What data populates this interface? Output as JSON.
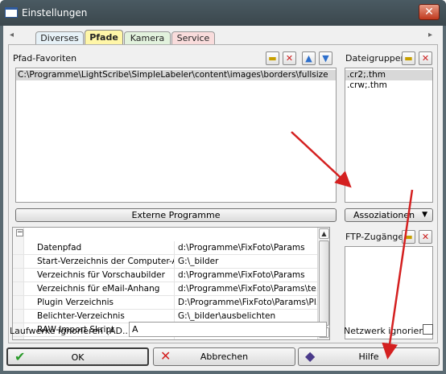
{
  "window": {
    "title": "Einstellungen",
    "close_glyph": "✕"
  },
  "tabs": [
    {
      "label": "Diverses",
      "color": "#e6f1f7"
    },
    {
      "label": "Pfade",
      "color": "#fff6a8",
      "active": true
    },
    {
      "label": "Kamera",
      "color": "#e2f2dd"
    },
    {
      "label": "Service",
      "color": "#f9dcdc"
    }
  ],
  "tab_scroll": {
    "left": "◂",
    "right": "▸"
  },
  "favorites": {
    "label": "Pfad-Favoriten",
    "items": [
      "C:\\Programme\\LightScribe\\SimpleLabeler\\content\\images\\borders\\fullsize"
    ]
  },
  "file_groups": {
    "label": "Dateigruppen",
    "items": [
      ".cr2;.thm",
      ".crw;.thm"
    ]
  },
  "external_programs_label": "Externe Programme",
  "associations_label": "Assoziationen",
  "ftp": {
    "label": "FTP-Zugänge"
  },
  "props": {
    "collapse_glyph": "−",
    "rows": [
      {
        "name": "Datenpfad",
        "value": "d:\\Programme\\FixFoto\\Params"
      },
      {
        "name": "Start-Verzeichnis der Computer-An...",
        "value": "G:\\_bilder"
      },
      {
        "name": "Verzeichnis für Vorschaubilder",
        "value": "d:\\Programme\\FixFoto\\Params"
      },
      {
        "name": "Verzeichnis für eMail-Anhang",
        "value": "d:\\Programme\\FixFoto\\Params\\te..."
      },
      {
        "name": "Plugin Verzeichnis",
        "value": "D:\\Programme\\FixFoto\\Params\\Pl..."
      },
      {
        "name": "Belichter-Verzeichnis",
        "value": "G:\\_bilder\\ausbelichten"
      },
      {
        "name": "RAW-Import Skript",
        "value": ""
      }
    ]
  },
  "drives_ignore": {
    "label": "Laufwerke ignorieren (AD...)",
    "value": "A"
  },
  "network_ignore": {
    "label": "Netzwerk ignorieren",
    "checked": false
  },
  "buttons": {
    "ok": "OK",
    "cancel": "Abbrechen",
    "help": "Hilfe"
  },
  "colors": {
    "annotation_arrow": "#d42020",
    "ok_check": "#2a9a2a",
    "cancel_x": "#d42020"
  }
}
